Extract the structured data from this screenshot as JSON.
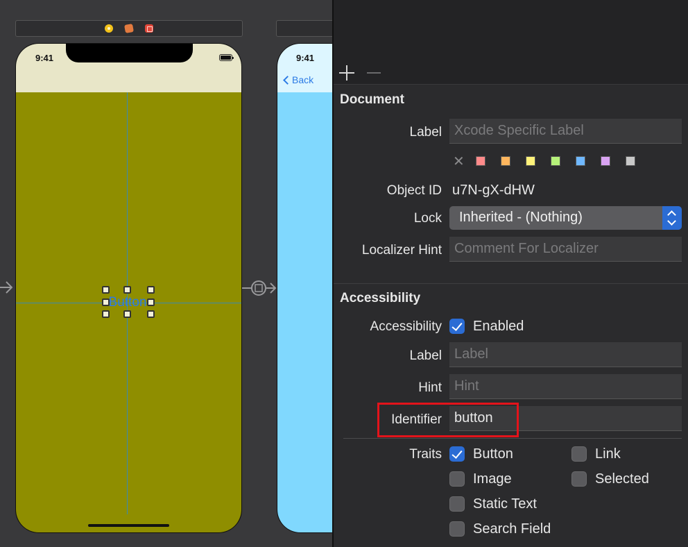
{
  "canvas": {
    "status_time": "9:41",
    "button_text": "Button",
    "back_label": "Back",
    "colors": {
      "view_bg": "#8f8e00",
      "status_bg": "#e8e6c8",
      "second_view_bg": "#80d8fe"
    }
  },
  "inspector": {
    "document": {
      "title": "Document",
      "label_label": "Label",
      "label_placeholder": "Xcode Specific Label",
      "object_id_label": "Object ID",
      "object_id_value": "u7N-gX-dHW",
      "lock_label": "Lock",
      "lock_value": "Inherited - (Nothing)",
      "localizer_label": "Localizer Hint",
      "localizer_placeholder": "Comment For Localizer",
      "swatch_colors": [
        "#ff8a8a",
        "#ffb65e",
        "#fff27a",
        "#b6f27a",
        "#6fb8ff",
        "#d9a3f2",
        "#c8c8c8"
      ]
    },
    "accessibility": {
      "title": "Accessibility",
      "accessibility_label": "Accessibility",
      "enabled_label": "Enabled",
      "label_label": "Label",
      "label_placeholder": "Label",
      "hint_label": "Hint",
      "hint_placeholder": "Hint",
      "identifier_label": "Identifier",
      "identifier_value": "button",
      "traits_label": "Traits",
      "traits": {
        "button": "Button",
        "link": "Link",
        "image": "Image",
        "selected": "Selected",
        "static_text": "Static Text",
        "search_field": "Search Field"
      }
    }
  }
}
